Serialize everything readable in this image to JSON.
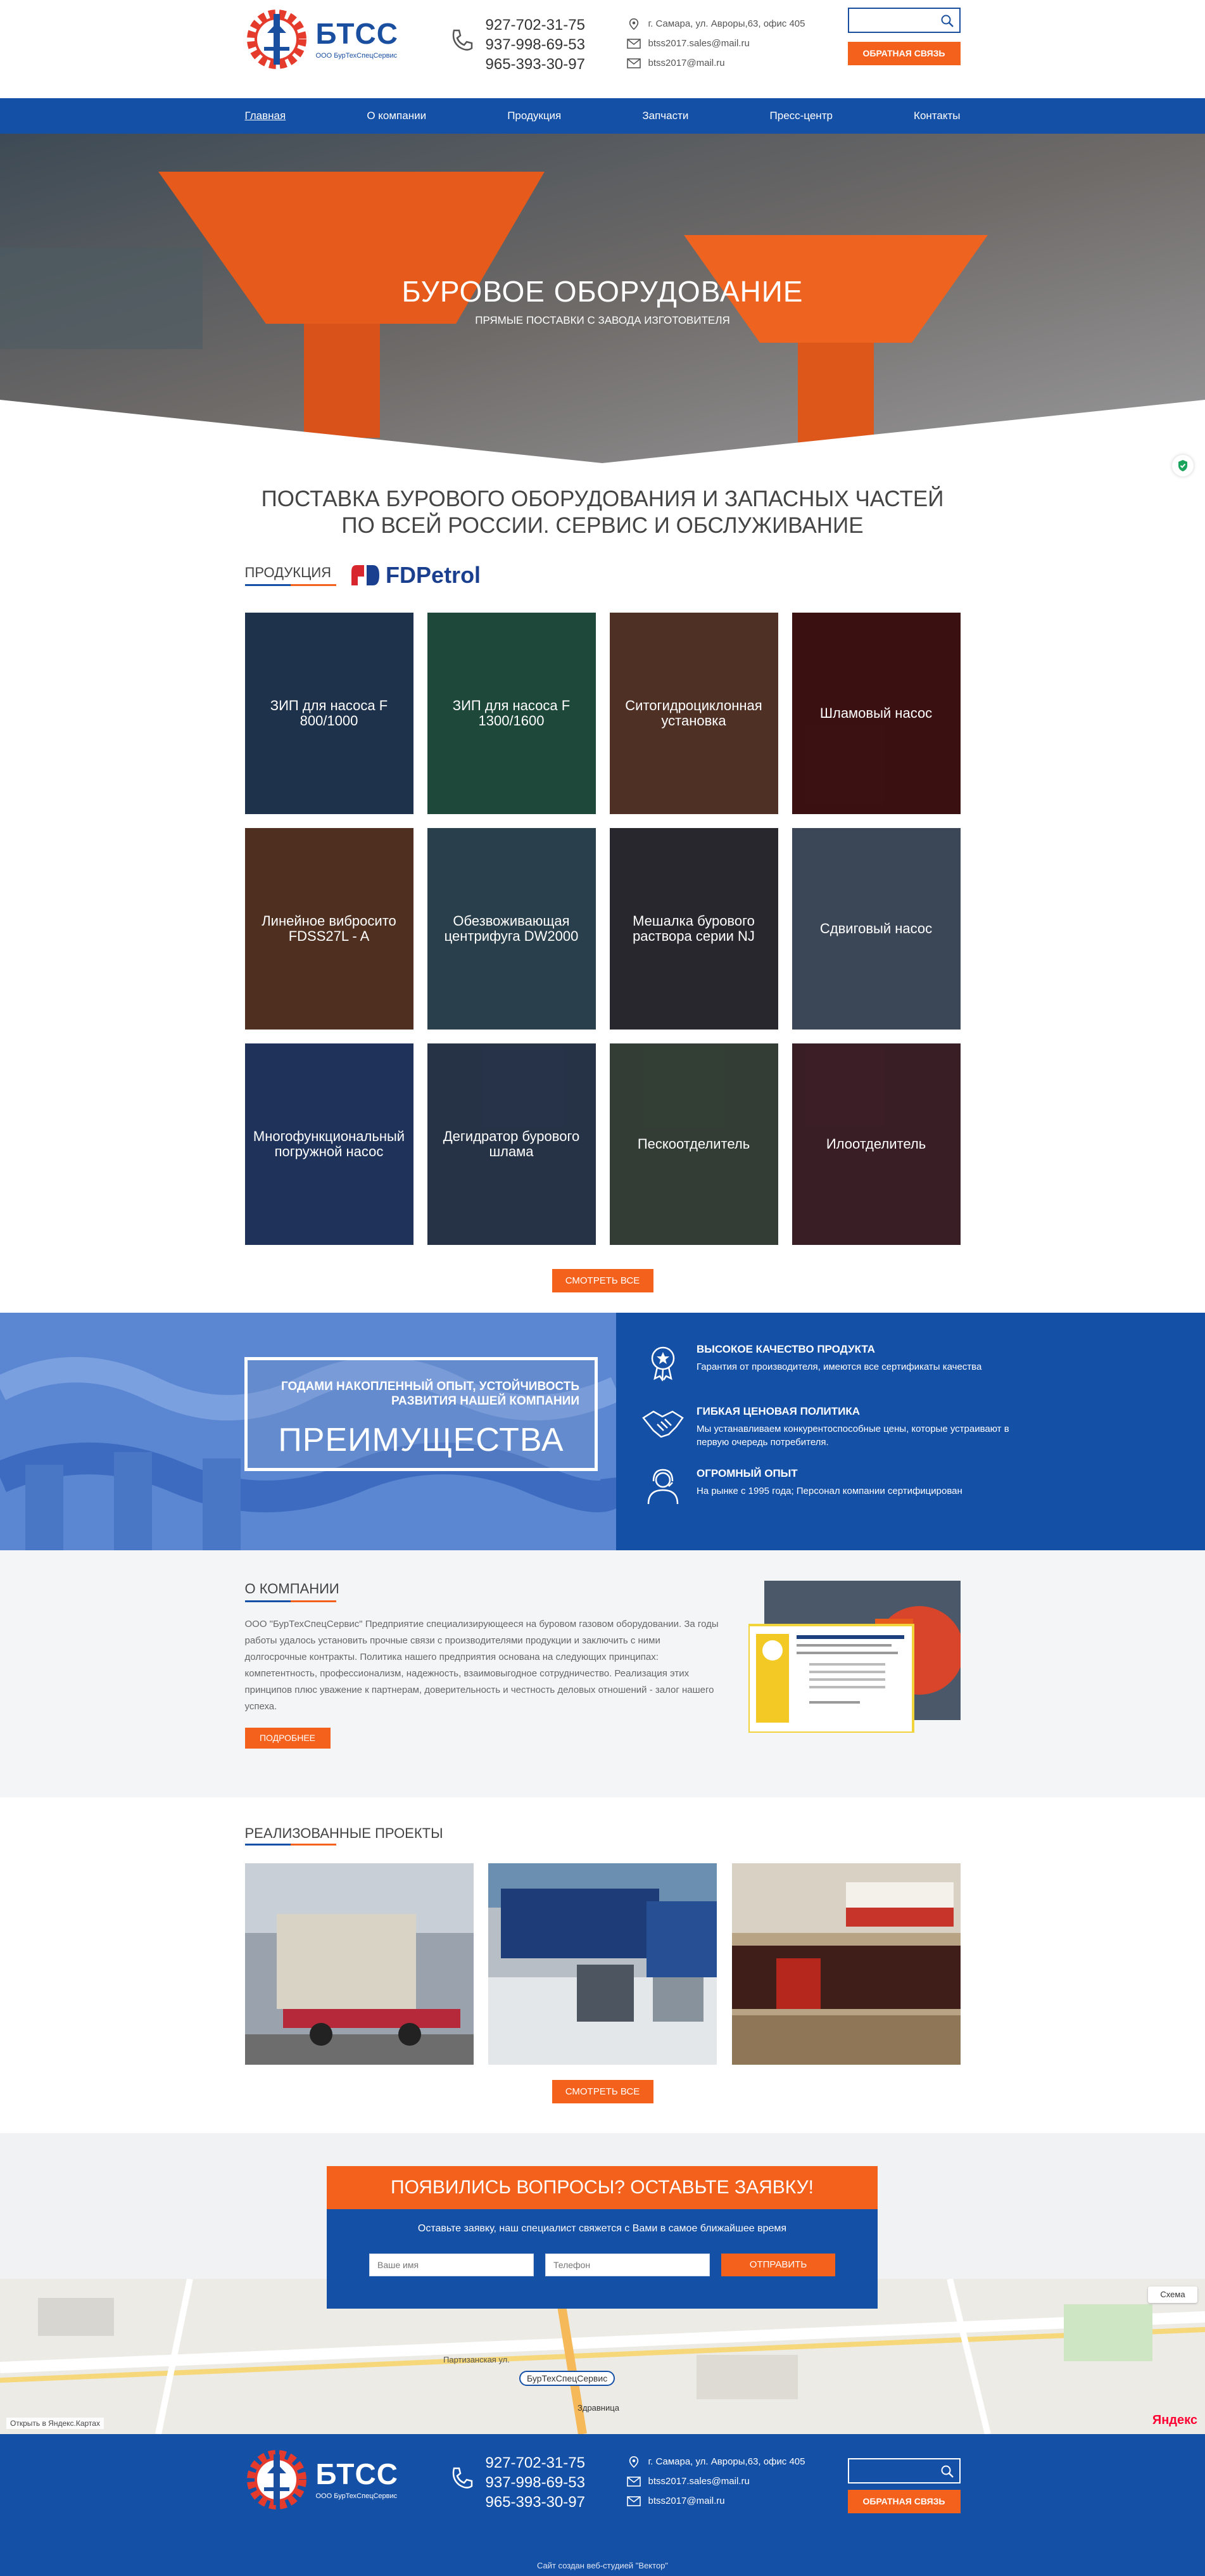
{
  "header": {
    "logo_text": "БТСС",
    "logo_sub": "ООО БурТехСпецСервис",
    "phones": [
      "927-702-31-75",
      "937-998-69-53",
      "965-393-30-97"
    ],
    "address": "г. Самара, ул. Авроры,63, офис 405",
    "email1": "btss2017.sales@mail.ru",
    "email2": "btss2017@mail.ru",
    "callback": "ОБРАТНАЯ СВЯЗЬ"
  },
  "nav": [
    "Главная",
    "О компании",
    "Продукция",
    "Запчасти",
    "Пресс-центр",
    "Контакты"
  ],
  "hero": {
    "title": "БУРОВОЕ ОБОРУДОВАНИЕ",
    "subtitle": "ПРЯМЫЕ ПОСТАВКИ С ЗАВОДА ИЗГОТОВИТЕЛЯ"
  },
  "intro": {
    "headline": "ПОСТАВКА БУРОВОГО ОБОРУДОВАНИЯ И ЗАПАСНЫХ ЧАСТЕЙ ПО ВСЕЙ РОССИИ. СЕРВИС И ОБСЛУЖИВАНИЕ"
  },
  "products": {
    "title": "ПРОДУКЦИЯ",
    "brand": "FDPetrol",
    "items": [
      {
        "label": "ЗИП для насоса F 800/1000",
        "bg": "#2f4e74"
      },
      {
        "label": "ЗИП для насоса F 1300/1600",
        "bg": "#2f6f5a"
      },
      {
        "label": "Ситогидроциклонная установка",
        "bg": "#7a4a3a"
      },
      {
        "label": "Шламовый насос",
        "bg": "#5a1a1a"
      },
      {
        "label": "Линейное вибросито FDSS27L - A",
        "bg": "#7a4a32"
      },
      {
        "label": "Обезвоживающая центрифуга DW2000",
        "bg": "#3f6274"
      },
      {
        "label": "Мешалка бурового раствора серии NJ",
        "bg": "#3d3d46"
      },
      {
        "label": "Сдвиговый насос",
        "bg": "#5b6e86"
      },
      {
        "label": "Многофункциональный погружной насос",
        "bg": "#2f4e8a"
      },
      {
        "label": "Дегидратор бурового шлама",
        "bg": "#3b4f6e"
      },
      {
        "label": "Пескоотделитель",
        "bg": "#4f5f52"
      },
      {
        "label": "Илоотделитель",
        "bg": "#5a2e3a"
      }
    ],
    "more": "СМОТРЕТЬ ВСЕ"
  },
  "advantages": {
    "kicker": "ГОДАМИ НАКОПЛЕННЫЙ ОПЫТ, УСТОЙЧИВОСТЬ РАЗВИТИЯ НАШЕЙ КОМПАНИИ",
    "title": "ПРЕИМУЩЕСТВА",
    "items": [
      {
        "heading": "ВЫСОКОЕ КАЧЕСТВО ПРОДУКТА",
        "text": "Гарантия от производителя, имеются все сертификаты качества"
      },
      {
        "heading": "ГИБКАЯ ЦЕНОВАЯ ПОЛИТИКА",
        "text": "Мы устанавливаем конкурентоспособные цены, которые устраивают в первую очередь потребителя."
      },
      {
        "heading": "ОГРОМНЫЙ ОПЫТ",
        "text": "На рынке с 1995 года; Персонал компании сертифицирован"
      }
    ]
  },
  "about": {
    "title": "О КОМПАНИИ",
    "text": "ООО \"БурТехСпецСервис\" Предприятие специализирующееся на буровом газовом оборудовании. За годы работы удалось установить прочные связи с производителями продукции и заключить с ними долгосрочные контракты. Политика нашего предприятия основана на следующих принципах: компетентность, профессионализм, надежность, взаимовыгодное сотрудничество. Реализация этих принципов плюс уважение к партнерам, доверительность и честность деловых отношений - залог нашего успеха.",
    "more": "ПОДРОБНЕЕ"
  },
  "projects": {
    "title": "РЕАЛИЗОВАННЫЕ ПРОЕКТЫ",
    "more": "СМОТРЕТЬ ВСЕ"
  },
  "request": {
    "title": "ПОЯВИЛИСЬ ВОПРОСЫ? ОСТАВЬТЕ ЗАЯВКУ!",
    "text": "Оставьте заявку, наш специалист свяжется с Вами в самое ближайшее время",
    "name_placeholder": "Ваше имя",
    "phone_placeholder": "Телефон",
    "send": "ОТПРАВИТЬ"
  },
  "map": {
    "scheme": "Схема",
    "open": "Открыть в Яндекс.Картах",
    "pin": "БурТехСпецСервис",
    "stop": "Здравница",
    "street": "Партизанская ул.",
    "yandex": "Яндекс"
  },
  "footer": {
    "copyright": "Сайт создан веб-студией \"Вектор\""
  }
}
